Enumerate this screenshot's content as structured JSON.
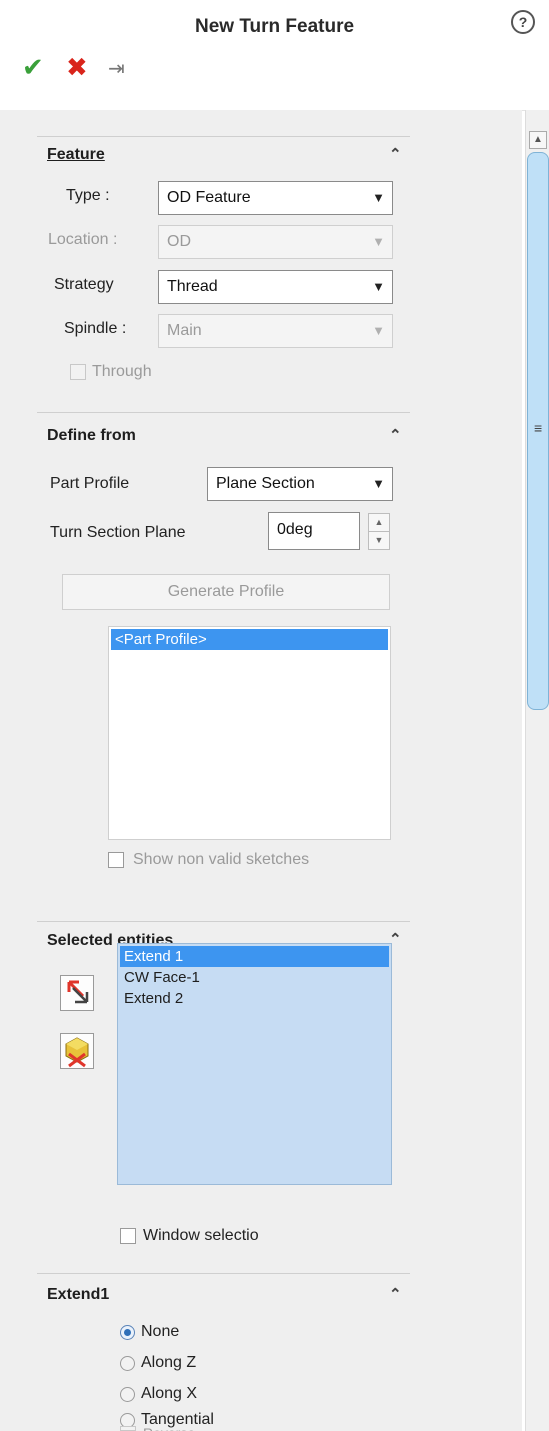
{
  "header": {
    "title": "New Turn Feature",
    "help_icon": "?",
    "ok_icon": "✔",
    "cancel_icon": "✖",
    "pin_icon": "⇥"
  },
  "scrollbar": {
    "up_arrow": "▲",
    "grip": "≡"
  },
  "feature": {
    "title": "Feature",
    "collapse_icon": "⌃",
    "type_label": "Type :",
    "type_value": "OD Feature",
    "location_label": "Location :",
    "location_value": "OD",
    "strategy_label": "Strategy",
    "strategy_value": "Thread",
    "spindle_label": "Spindle :",
    "spindle_value": "Main",
    "through_label": "Through"
  },
  "define_from": {
    "title": "Define from",
    "collapse_icon": "⌃",
    "part_profile_label": "Part Profile",
    "part_profile_value": "Plane Section",
    "turn_section_label": "Turn Section Plane",
    "turn_section_value": "0deg",
    "spin_up": "▲",
    "spin_down": "▼",
    "generate_label": "Generate Profile",
    "list_items": [
      "<Part Profile>"
    ],
    "show_non_valid_label": "Show non valid sketches"
  },
  "selected_entities": {
    "title": "Selected entities",
    "collapse_icon": "⌃",
    "items": [
      "Extend 1",
      "CW Face-1",
      "Extend 2"
    ],
    "window_selection_label": "Window selectio"
  },
  "extend1": {
    "title": "Extend1",
    "collapse_icon": "⌃",
    "options": [
      "None",
      "Along Z",
      "Along X",
      "Tangential"
    ],
    "selected": "None",
    "reverse_label": "Reverse"
  },
  "colors": {
    "accent": "#3d95f0",
    "selection_bg": "#c6dcf3",
    "ok": "#3aa03a",
    "cancel": "#d9241b"
  }
}
